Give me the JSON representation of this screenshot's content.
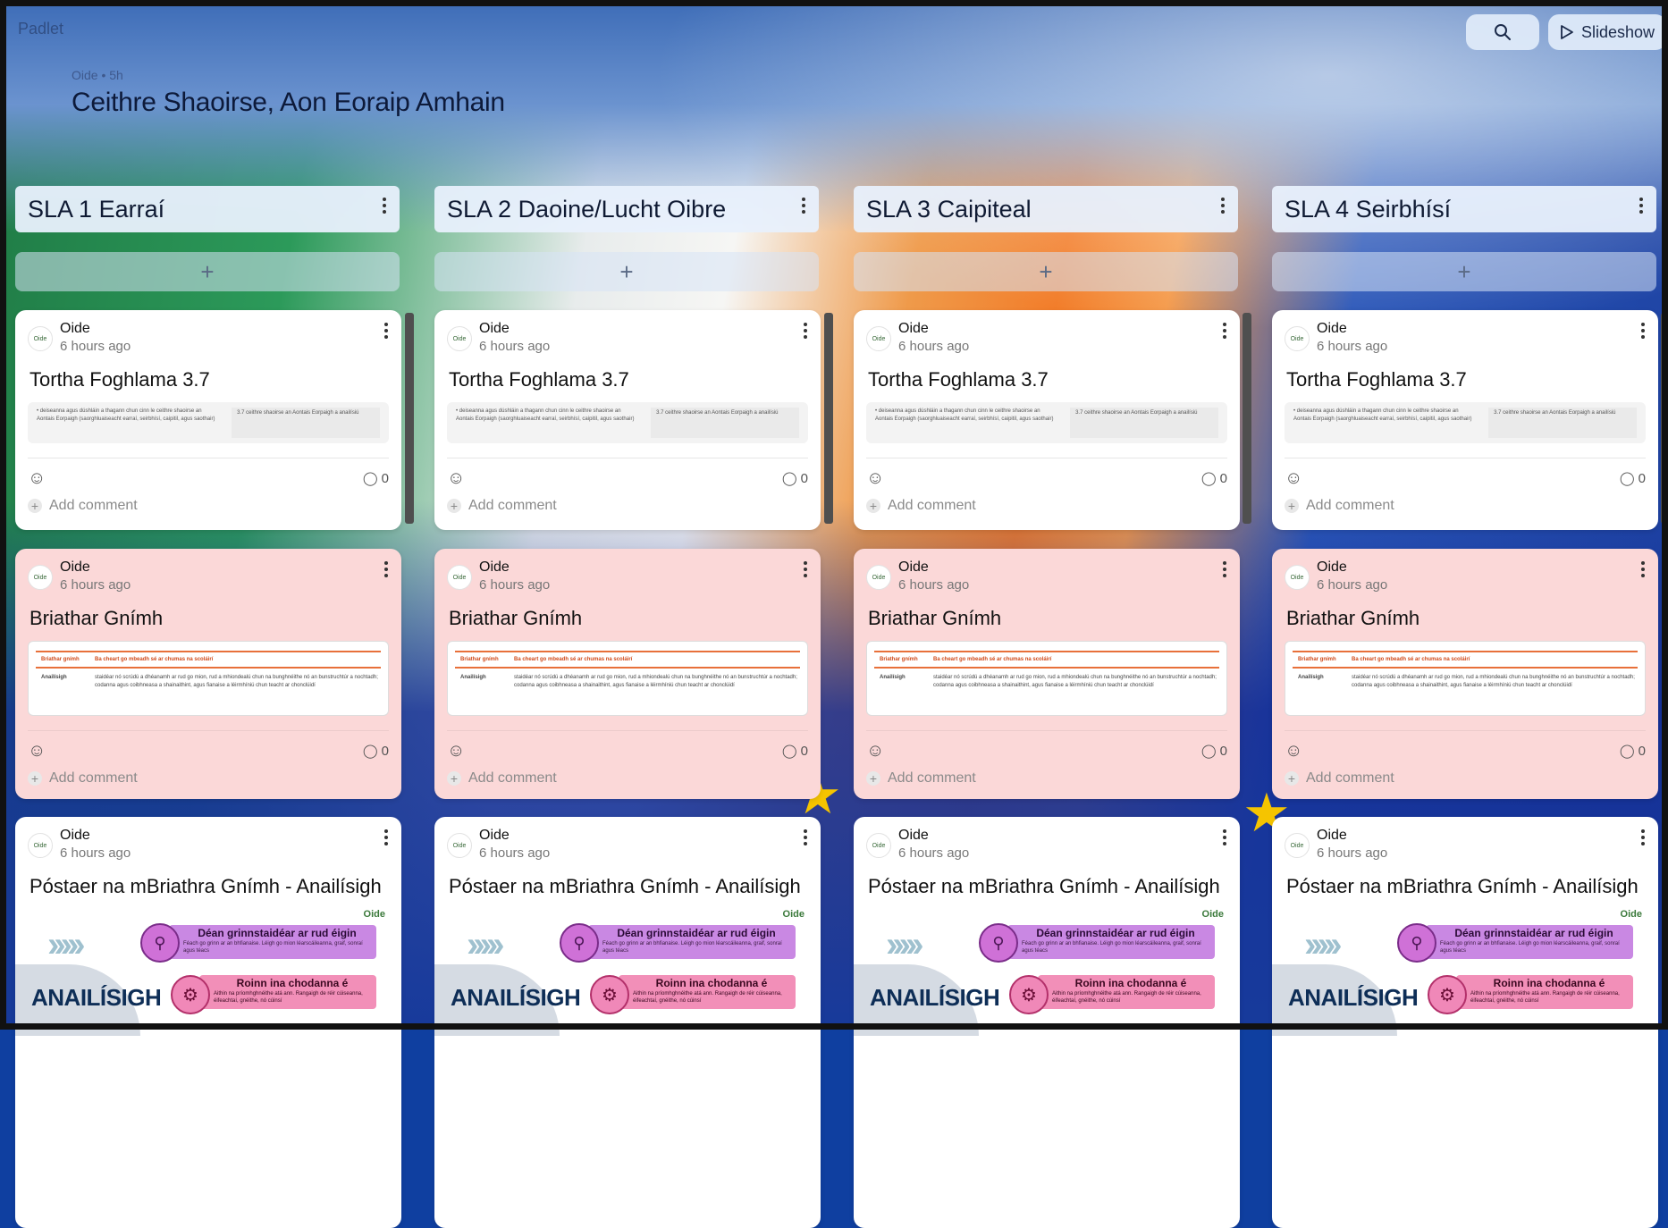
{
  "header": {
    "brand": "Padlet",
    "meta": "Oide • 5h",
    "title": "Ceithre Shaoirse, Aon Eoraip Amhain",
    "slideshow_label": "Slideshow"
  },
  "columns": [
    {
      "title": "SLA 1 Earraí"
    },
    {
      "title": "SLA 2 Daoine/Lucht Oibre"
    },
    {
      "title": "SLA 3 Caipiteal"
    },
    {
      "title": "SLA 4 Seirbhísí"
    }
  ],
  "cards": {
    "author": "Oide",
    "avatar_text": "Oide",
    "time": "6 hours ago",
    "comment_count": "0",
    "add_comment": "Add comment",
    "card1": {
      "title": "Tortha Foghlama 3.7",
      "thumb_left": "• deiseanna agus dúshláin a thagann chun cinn le ceithre shaoirse an Aontais Eorpaigh (saorghluaiseacht earraí, seirbhísí, caipitil, agus saothair)",
      "thumb_right": "3.7   ceithre shaoirse an Aontais Eorpaigh a anailísiú"
    },
    "card2": {
      "title": "Briathar Gnímh",
      "row1_left": "Briathar gnímh",
      "row1_right": "Ba cheart go mbeadh sé ar chumas na scoláirí",
      "row2_left": "Anailísigh",
      "row2_right": "staidéar nó scrúdú a dhéanamh ar rud go mion, rud a mhiondealú chun na bunghnéithe nó an bunstruchtúr a nochtadh; codanna agus coibhneasa a shainaithint, agus fianaise a léirmhíniú chun teacht ar chonclúidí"
    },
    "card3": {
      "title": "Póstaer na mBriathra Gnímh - Anailísigh",
      "logo": "Oide",
      "box1_title": "Déan grinnstaidéar ar rud éigin",
      "box1_text": "Féach go grinn ar an bhfianaise. Léigh go mion léarscáileanna, graif, sonraí agus téacs",
      "box2_title": "Roinn ina chodanna é",
      "box2_text": "Aithin na príomhghnéithe atá ann. Rangaigh de réir cúiseanna, éifeachtaí, gnéithe, nó cúinsí",
      "big_word": "ANAILÍSIGH"
    }
  },
  "icons": {
    "search": "search-icon",
    "play": "play-icon",
    "more": "more-vertical-icon",
    "plus": "plus-icon",
    "emoji": "emoji-add-icon",
    "comment": "comment-icon"
  },
  "colors": {
    "card_white": "#ffffff",
    "card_pink": "#fbd8d8",
    "column_header": "#e8f0fc"
  }
}
